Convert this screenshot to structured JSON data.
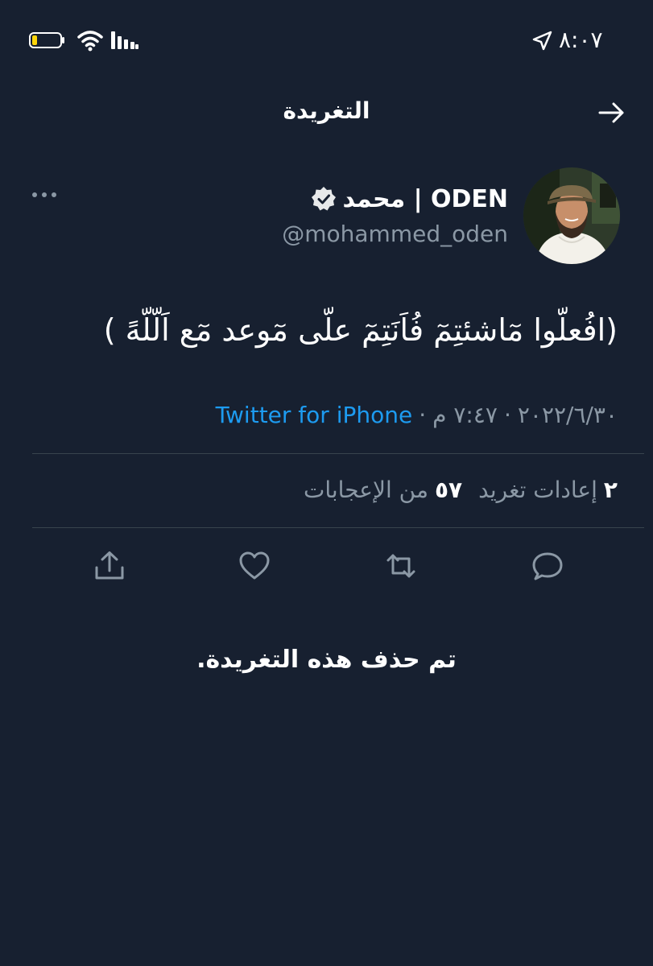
{
  "status_bar": {
    "time": "٨:٠٧",
    "icons": [
      "battery-icon",
      "wifi-icon",
      "signal-icon",
      "location-icon"
    ]
  },
  "header": {
    "title": "التغريدة",
    "back_icon": "arrow-right-icon"
  },
  "tweet": {
    "display_name": "محمد | ODEN",
    "handle": "@mohammed_oden",
    "verified": true,
    "text": "(افُعلّوا مٓاشئتِمٓ فُاَنَتِمٓ علّى مٓوعد مٓع اَلّلّهً )",
    "date": "٢٠٢٢/٦/٣٠",
    "time": "٧:٤٧ م",
    "source": "Twitter for iPhone",
    "retweets_count": "٢",
    "retweets_label": "إعادات تغريد",
    "likes_count": "٥٧",
    "likes_label": "من الإعجابات"
  },
  "actions": [
    "share-icon",
    "like-icon",
    "retweet-icon",
    "reply-icon"
  ],
  "deleted_message": "تم حذف هذه التغريدة.",
  "colors": {
    "background": "#172030",
    "text": "#ffffff",
    "secondary_text": "#8b98a5",
    "link": "#1d9bf0",
    "divider": "#38444d"
  }
}
